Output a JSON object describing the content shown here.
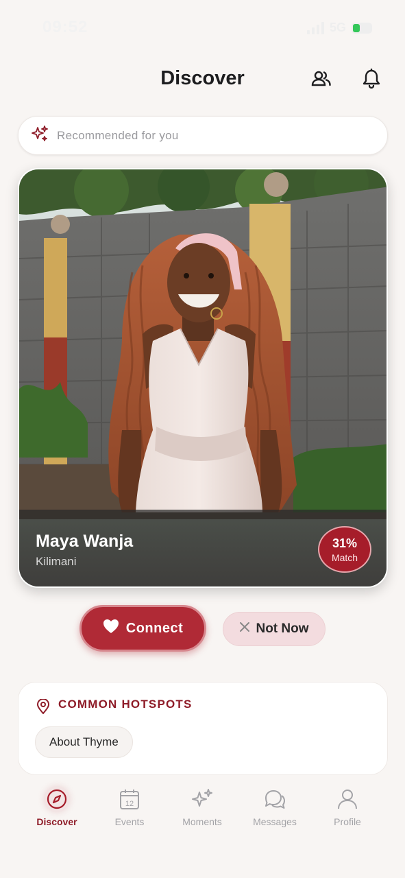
{
  "status_bar": {
    "time": "09:52",
    "network": "5G"
  },
  "header": {
    "title": "Discover",
    "friends_icon": "people-icon",
    "notifications_icon": "bell-icon"
  },
  "recommendation": {
    "icon": "sparkles-icon",
    "text": "Recommended for you"
  },
  "profile": {
    "name": "Maya Wanja",
    "location": "Kilimani",
    "match_percent": "31%",
    "match_label": "Match"
  },
  "actions": {
    "connect_label": "Connect",
    "not_now_label": "Not Now"
  },
  "hotspots": {
    "title": "COMMON HOTSPOTS",
    "items": [
      "About Thyme"
    ]
  },
  "tabs": [
    {
      "label": "Discover",
      "icon": "compass-icon",
      "active": true
    },
    {
      "label": "Events",
      "icon": "calendar-icon",
      "icon_text": "12",
      "active": false
    },
    {
      "label": "Moments",
      "icon": "sparkles-icon",
      "active": false
    },
    {
      "label": "Messages",
      "icon": "chat-bubbles-icon",
      "active": false
    },
    {
      "label": "Profile",
      "icon": "person-icon",
      "active": false
    }
  ],
  "colors": {
    "accent": "#b02a36",
    "accent_dark": "#8e1b27",
    "background": "#f8f5f3"
  }
}
